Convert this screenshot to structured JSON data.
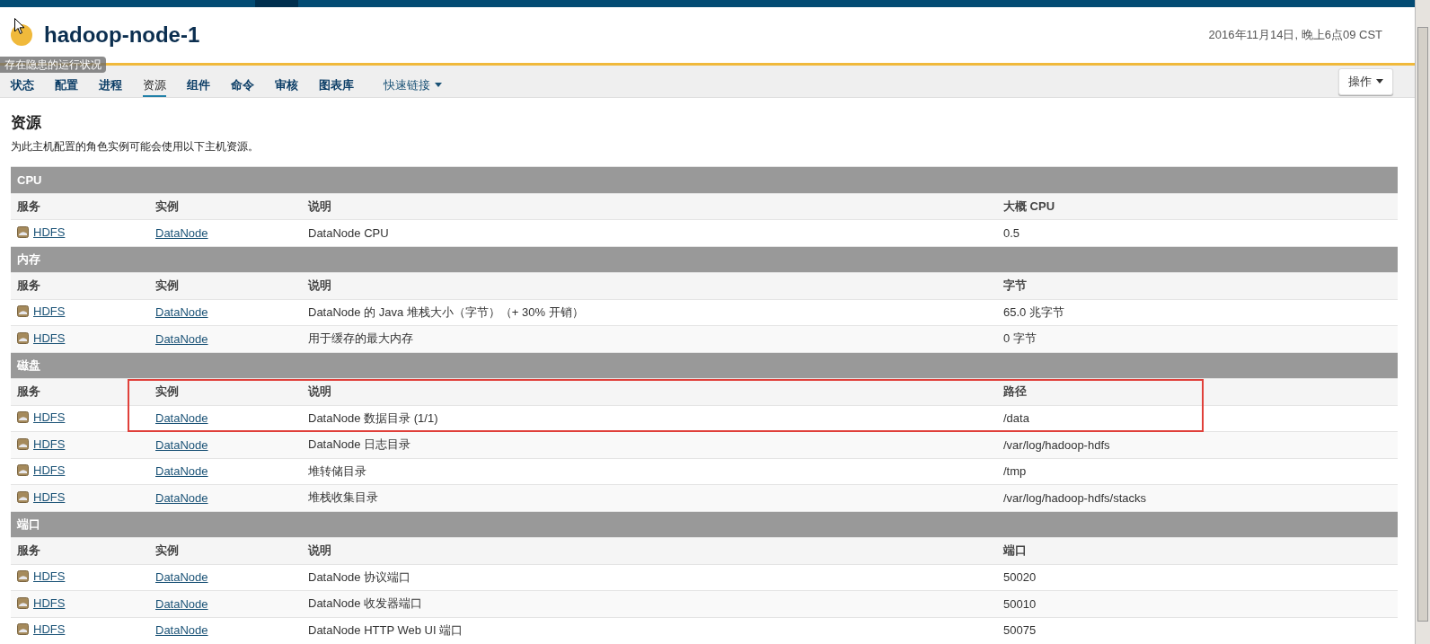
{
  "host": {
    "name": "hadoop-node-1",
    "health_tooltip": "存在隐患的运行状况"
  },
  "timestamp": "2016年11月14日, 晚上6点09 CST",
  "tabs": [
    {
      "label": "状态",
      "selected": false
    },
    {
      "label": "配置",
      "selected": false
    },
    {
      "label": "进程",
      "selected": false
    },
    {
      "label": "资源",
      "selected": true
    },
    {
      "label": "组件",
      "selected": false
    },
    {
      "label": "命令",
      "selected": false
    },
    {
      "label": "审核",
      "selected": false
    },
    {
      "label": "图表库",
      "selected": false
    }
  ],
  "quick_links": "快速链接",
  "actions_button": "操作",
  "page": {
    "title": "资源",
    "description": "为此主机配置的角色实例可能会使用以下主机资源。"
  },
  "sections": [
    {
      "title": "CPU",
      "columns": [
        "服务",
        "实例",
        "说明",
        "大概 CPU"
      ],
      "rows": [
        {
          "service": "HDFS",
          "instance": "DataNode",
          "description": "DataNode CPU",
          "value": "0.5"
        }
      ]
    },
    {
      "title": "内存",
      "columns": [
        "服务",
        "实例",
        "说明",
        "字节"
      ],
      "rows": [
        {
          "service": "HDFS",
          "instance": "DataNode",
          "description": "DataNode 的 Java 堆栈大小（字节）（+ 30% 开销）",
          "value": "65.0 兆字节"
        },
        {
          "service": "HDFS",
          "instance": "DataNode",
          "description": "用于缓存的最大内存",
          "value": "0 字节"
        }
      ]
    },
    {
      "title": "磁盘",
      "columns": [
        "服务",
        "实例",
        "说明",
        "路径"
      ],
      "rows": [
        {
          "service": "HDFS",
          "instance": "DataNode",
          "description": "DataNode 数据目录 (1/1)",
          "value": "/data",
          "annotated": true
        },
        {
          "service": "HDFS",
          "instance": "DataNode",
          "description": "DataNode 日志目录",
          "value": "/var/log/hadoop-hdfs"
        },
        {
          "service": "HDFS",
          "instance": "DataNode",
          "description": "堆转储目录",
          "value": "/tmp"
        },
        {
          "service": "HDFS",
          "instance": "DataNode",
          "description": "堆栈收集目录",
          "value": "/var/log/hadoop-hdfs/stacks"
        }
      ]
    },
    {
      "title": "端口",
      "columns": [
        "服务",
        "实例",
        "说明",
        "端口"
      ],
      "rows": [
        {
          "service": "HDFS",
          "instance": "DataNode",
          "description": "DataNode 协议端口",
          "value": "50020"
        },
        {
          "service": "HDFS",
          "instance": "DataNode",
          "description": "DataNode 收发器端口",
          "value": "50010"
        },
        {
          "service": "HDFS",
          "instance": "DataNode",
          "description": "DataNode HTTP Web UI 端口",
          "value": "50075"
        }
      ]
    }
  ]
}
